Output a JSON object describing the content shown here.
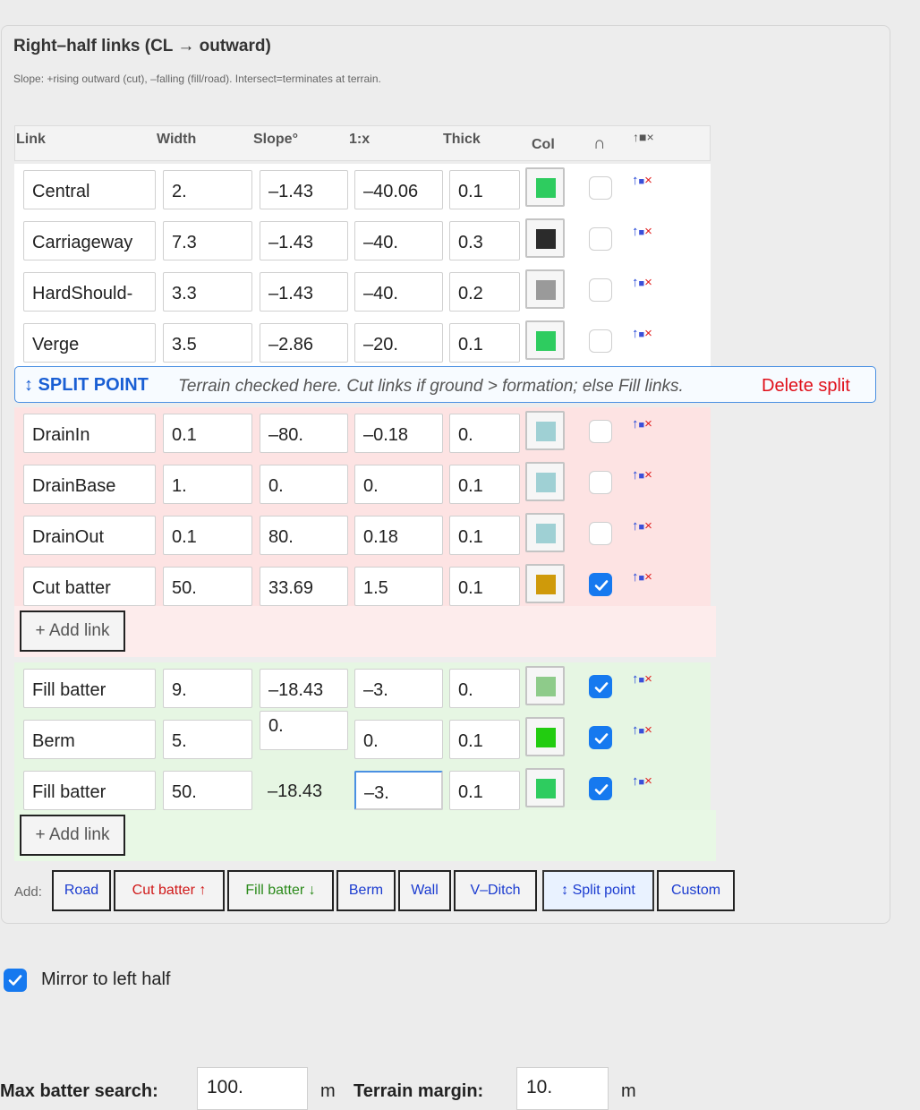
{
  "panel": {
    "title": "Right–half links (CL → outward)",
    "subtitle": "Slope: +rising outward (cut), –falling (fill/road). Intersect=terminates at terrain."
  },
  "table": {
    "headers": [
      "Link",
      "Width",
      "Slope°",
      "1:x",
      "Thick",
      "Col",
      "∩",
      "↑■×"
    ],
    "road_rows": [
      {
        "link": "Central",
        "width": "2.",
        "slope": "–1.43",
        "ratio": "–40.06",
        "thick": "0.1",
        "color": "#2ecc5f",
        "intersect": false
      },
      {
        "link": "Carriageway",
        "width": "7.3",
        "slope": "–1.43",
        "ratio": "–40.",
        "thick": "0.3",
        "color": "#2b2b2b",
        "intersect": false
      },
      {
        "link": "HardShould-",
        "width": "3.3",
        "slope": "–1.43",
        "ratio": "–40.",
        "thick": "0.2",
        "color": "#9a9a9a",
        "intersect": false
      },
      {
        "link": "Verge",
        "width": "3.5",
        "slope": "–2.86",
        "ratio": "–20.",
        "thick": "0.1",
        "color": "#2ecc5f",
        "intersect": false
      }
    ],
    "cut_rows": [
      {
        "link": "DrainIn",
        "width": "0.1",
        "slope": "–80.",
        "ratio": "–0.18",
        "thick": "0.",
        "color": "#9fd0d4",
        "intersect": false
      },
      {
        "link": "DrainBase",
        "width": "1.",
        "slope": "0.",
        "ratio": "0.",
        "thick": "0.1",
        "color": "#9fd0d4",
        "intersect": false
      },
      {
        "link": "DrainOut",
        "width": "0.1",
        "slope": "80.",
        "ratio": "0.18",
        "thick": "0.1",
        "color": "#9fd0d4",
        "intersect": false
      },
      {
        "link": "Cut batter",
        "width": "50.",
        "slope": "33.69",
        "ratio": "1.5",
        "thick": "0.1",
        "color": "#cf9a0a",
        "intersect": true
      }
    ],
    "fill_rows": [
      {
        "link": "Fill batter",
        "width": "9.",
        "slope": "–18.43",
        "ratio": "–3.",
        "thick": "0.",
        "color": "#8ecb8a",
        "intersect": true
      },
      {
        "link": "Berm",
        "width": "5.",
        "slope": "0.",
        "ratio": "0.",
        "thick": "0.1",
        "color": "#22cc10",
        "intersect": true
      },
      {
        "link": "Fill batter",
        "width": "50.",
        "slope": "–18.43",
        "ratio": "–3.",
        "thick": "0.1",
        "color": "#2ecc5f",
        "intersect": true
      }
    ],
    "row_actions": {
      "up": "↑",
      "mid": "■",
      "del": "×"
    }
  },
  "split": {
    "label": "↕ SPLIT POINT",
    "note": "Terrain checked here. Cut links if ground > formation; else Fill links.",
    "delete": "Delete split"
  },
  "add_link_label": "+ Add link",
  "toolbar": {
    "add_label": "Add:",
    "buttons": [
      {
        "label": "Road",
        "color": "#1a3bd0"
      },
      {
        "label": "Cut batter ↑",
        "color": "#d01818"
      },
      {
        "label": "Fill batter ↓",
        "color": "#2a8a1a"
      },
      {
        "label": "Berm",
        "color": "#1a3bd0"
      },
      {
        "label": "Wall",
        "color": "#1a3bd0"
      },
      {
        "label": "V–Ditch",
        "color": "#1a3bd0"
      },
      {
        "label": "↕ Split point",
        "color": "#1a3bd0"
      },
      {
        "label": "Custom",
        "color": "#1a3bd0"
      }
    ]
  },
  "mirror": {
    "label": "Mirror to left half",
    "checked": true
  },
  "bottom": {
    "max_batter_label": "Max batter search:",
    "max_batter_value": "100.",
    "unit": "m",
    "terrain_margin_label": "Terrain margin:",
    "terrain_margin_value": "10."
  }
}
